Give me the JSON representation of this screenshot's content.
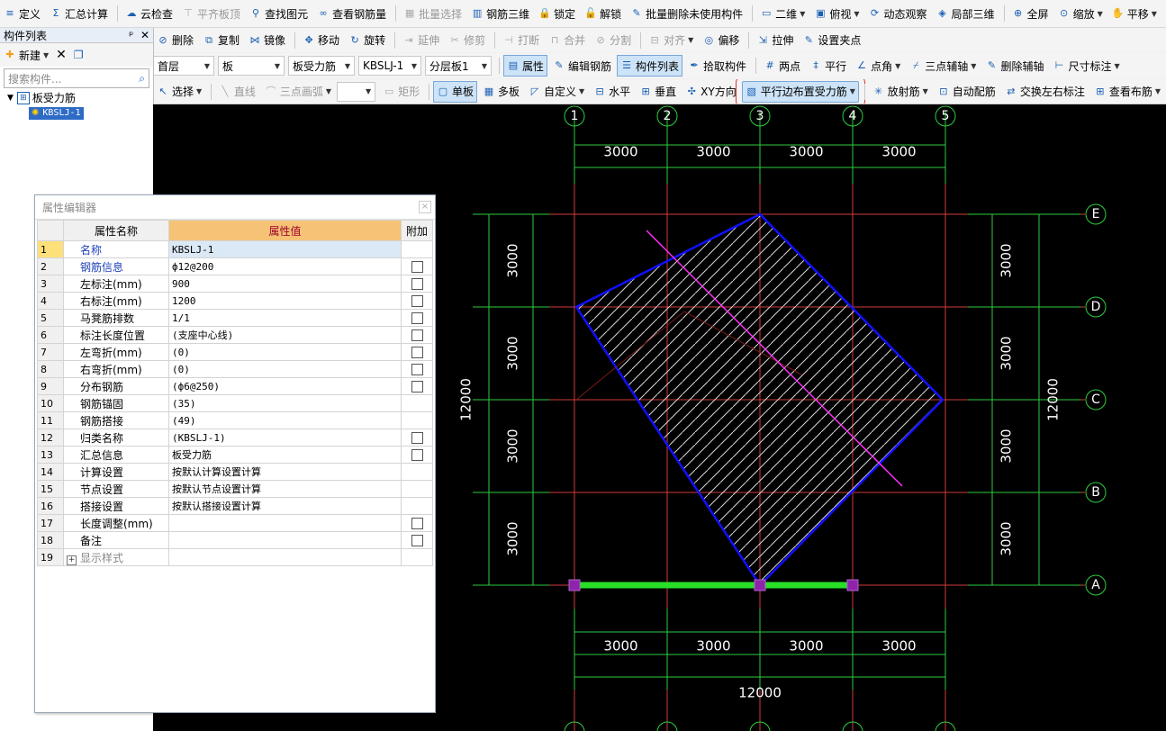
{
  "toolbar_main": [
    {
      "label": "定义",
      "icon": "define-icon"
    },
    {
      "label": "汇总计算",
      "icon": "sigma-icon"
    },
    {
      "label": "云检查",
      "icon": "cloud-check-icon"
    },
    {
      "label": "平齐板顶",
      "icon": "align-top-icon",
      "disabled": true
    },
    {
      "label": "查找图元",
      "icon": "binoculars-icon"
    },
    {
      "label": "查看钢筋量",
      "icon": "rebar-view-icon"
    },
    {
      "label": "批量选择",
      "icon": "batch-select-icon",
      "disabled": true
    },
    {
      "label": "钢筋三维",
      "icon": "rebar-3d-icon"
    },
    {
      "label": "锁定",
      "icon": "lock-icon"
    },
    {
      "label": "解锁",
      "icon": "unlock-icon"
    },
    {
      "label": "批量删除未使用构件",
      "icon": "batch-delete-icon"
    },
    {
      "label": "二维",
      "icon": "2d-icon",
      "dropdown": true
    },
    {
      "label": "俯视",
      "icon": "top-view-icon",
      "dropdown": true
    },
    {
      "label": "动态观察",
      "icon": "orbit-icon"
    },
    {
      "label": "局部三维",
      "icon": "local-3d-icon"
    },
    {
      "label": "全屏",
      "icon": "fullscreen-icon"
    },
    {
      "label": "缩放",
      "icon": "zoom-icon",
      "dropdown": true
    },
    {
      "label": "平移",
      "icon": "pan-icon",
      "dropdown": true
    }
  ],
  "toolbar_edit": [
    {
      "label": "删除",
      "icon": "delete-icon"
    },
    {
      "label": "复制",
      "icon": "copy-icon"
    },
    {
      "label": "镜像",
      "icon": "mirror-icon"
    },
    {
      "label": "移动",
      "icon": "move-icon"
    },
    {
      "label": "旋转",
      "icon": "rotate-icon"
    },
    {
      "label": "延伸",
      "icon": "extend-icon",
      "disabled": true
    },
    {
      "label": "修剪",
      "icon": "trim-icon",
      "disabled": true
    },
    {
      "label": "打断",
      "icon": "break-icon",
      "disabled": true
    },
    {
      "label": "合并",
      "icon": "merge-icon",
      "disabled": true
    },
    {
      "label": "分割",
      "icon": "split-icon",
      "disabled": true
    },
    {
      "label": "对齐",
      "icon": "align-icon",
      "disabled": true,
      "dropdown": true
    },
    {
      "label": "偏移",
      "icon": "offset-icon"
    },
    {
      "label": "拉伸",
      "icon": "stretch-icon"
    },
    {
      "label": "设置夹点",
      "icon": "grip-icon"
    }
  ],
  "toolbar_props": {
    "floor": "首层",
    "category": "板",
    "type": "板受力筋",
    "component": "KBSLJ-1",
    "layer": "分层板1",
    "buttons": [
      {
        "label": "属性",
        "icon": "properties-icon",
        "active": true
      },
      {
        "label": "编辑钢筋",
        "icon": "edit-rebar-icon"
      },
      {
        "label": "构件列表",
        "icon": "component-list-icon",
        "active": true
      },
      {
        "label": "拾取构件",
        "icon": "pick-icon"
      },
      {
        "label": "两点",
        "icon": "two-point-axis-icon"
      },
      {
        "label": "平行",
        "icon": "parallel-axis-icon"
      },
      {
        "label": "点角",
        "icon": "point-angle-icon",
        "dropdown": true
      },
      {
        "label": "三点辅轴",
        "icon": "three-point-axis-icon",
        "dropdown": true
      },
      {
        "label": "删除辅轴",
        "icon": "delete-axis-icon"
      },
      {
        "label": "尺寸标注",
        "icon": "dimension-icon",
        "dropdown": true
      }
    ]
  },
  "toolbar_draw": {
    "buttons": [
      {
        "label": "选择",
        "icon": "select-cursor-icon",
        "dropdown": true
      },
      {
        "label": "直线",
        "icon": "line-icon",
        "disabled": true
      },
      {
        "label": "三点画弧",
        "icon": "arc-icon",
        "disabled": true,
        "dropdown": true
      },
      {
        "label": "",
        "icon": "",
        "combo": true
      },
      {
        "label": "矩形",
        "icon": "rectangle-icon",
        "disabled": true
      },
      {
        "label": "单板",
        "icon": "single-slab-icon",
        "active": true
      },
      {
        "label": "多板",
        "icon": "multi-slab-icon"
      },
      {
        "label": "自定义",
        "icon": "custom-icon",
        "dropdown": true
      },
      {
        "label": "水平",
        "icon": "horizontal-icon"
      },
      {
        "label": "垂直",
        "icon": "vertical-icon"
      },
      {
        "label": "XY方向",
        "icon": "xy-direction-icon"
      },
      {
        "label": "平行边布置受力筋",
        "icon": "parallel-edge-icon",
        "active": true,
        "dropdown": true
      },
      {
        "label": "放射筋",
        "icon": "radial-icon",
        "dropdown": true
      },
      {
        "label": "自动配筋",
        "icon": "auto-rebar-icon"
      },
      {
        "label": "交换左右标注",
        "icon": "swap-label-icon"
      },
      {
        "label": "查看布筋",
        "icon": "view-rebar-icon",
        "dropdown": true
      }
    ]
  },
  "left_panel": {
    "title": "构件列表",
    "new_label": "新建",
    "search_placeholder": "搜索构件...",
    "tree_root": "板受力筋",
    "tree_child": "KBSLJ-1"
  },
  "property_editor": {
    "title": "属性编辑器",
    "headers": [
      "属性名称",
      "属性值",
      "附加"
    ],
    "rows": [
      {
        "n": "1",
        "name": "名称",
        "value": "KBSLJ-1",
        "check": false,
        "blue": true
      },
      {
        "n": "2",
        "name": "钢筋信息",
        "value": "ф12@200",
        "check": true,
        "blue": true
      },
      {
        "n": "3",
        "name": "左标注(mm)",
        "value": "900",
        "check": true
      },
      {
        "n": "4",
        "name": "右标注(mm)",
        "value": "1200",
        "check": true
      },
      {
        "n": "5",
        "name": "马凳筋排数",
        "value": "1/1",
        "check": true
      },
      {
        "n": "6",
        "name": "标注长度位置",
        "value": "(支座中心线)",
        "check": true
      },
      {
        "n": "7",
        "name": "左弯折(mm)",
        "value": "(0)",
        "check": true
      },
      {
        "n": "8",
        "name": "右弯折(mm)",
        "value": "(0)",
        "check": true
      },
      {
        "n": "9",
        "name": "分布钢筋",
        "value": "(ф6@250)",
        "check": true
      },
      {
        "n": "10",
        "name": "钢筋锚固",
        "value": "(35)",
        "check": false
      },
      {
        "n": "11",
        "name": "钢筋搭接",
        "value": "(49)",
        "check": false
      },
      {
        "n": "12",
        "name": "归类名称",
        "value": "(KBSLJ-1)",
        "check": true
      },
      {
        "n": "13",
        "name": "汇总信息",
        "value": "板受力筋",
        "check": true
      },
      {
        "n": "14",
        "name": "计算设置",
        "value": "按默认计算设置计算",
        "check": false
      },
      {
        "n": "15",
        "name": "节点设置",
        "value": "按默认节点设置计算",
        "check": false
      },
      {
        "n": "16",
        "name": "搭接设置",
        "value": "按默认搭接设置计算",
        "check": false
      },
      {
        "n": "17",
        "name": "长度调整(mm)",
        "value": "",
        "check": true
      },
      {
        "n": "18",
        "name": "备注",
        "value": "",
        "check": true
      },
      {
        "n": "19",
        "name": "显示样式",
        "value": "",
        "check": false,
        "expander": true
      }
    ]
  },
  "cad": {
    "columns": [
      "1",
      "2",
      "3",
      "4",
      "5"
    ],
    "rows": [
      "E",
      "D",
      "C",
      "B",
      "A"
    ],
    "spacing": "3000",
    "total": "12000",
    "colors": {
      "grid": "#d23a3a",
      "dim": "#2ecc40",
      "slab": "#1010ff",
      "rebar": "#ff30ff",
      "support": "#28e028",
      "grip": "#8e24aa"
    }
  }
}
